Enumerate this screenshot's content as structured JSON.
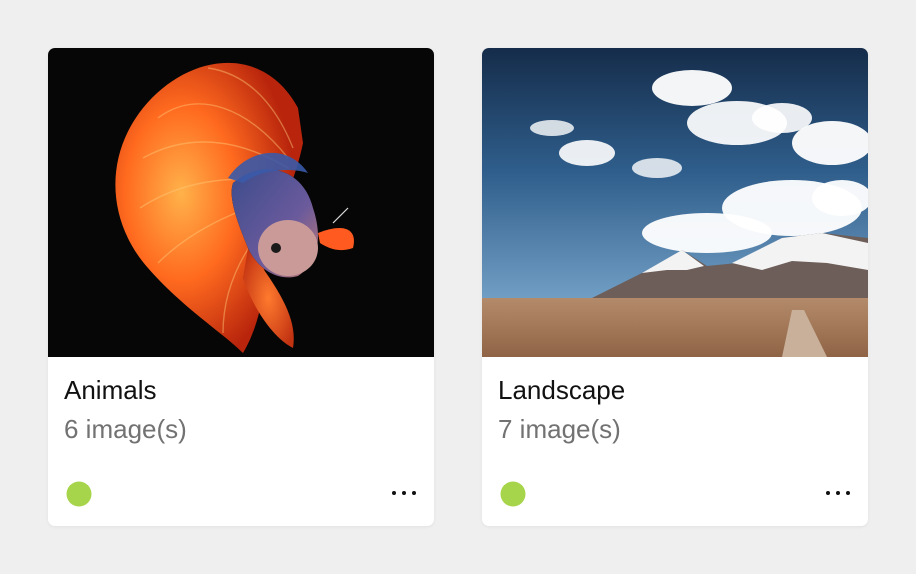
{
  "albums": [
    {
      "name": "Animals",
      "count": "6 image(s)",
      "status_color": "#a6d44a",
      "thumbnail": "betta-fish-photo"
    },
    {
      "name": "Landscape",
      "count": "7 image(s)",
      "status_color": "#a6d44a",
      "thumbnail": "mountain-desert-photo"
    }
  ],
  "more_icon": "more-horizontal-icon"
}
